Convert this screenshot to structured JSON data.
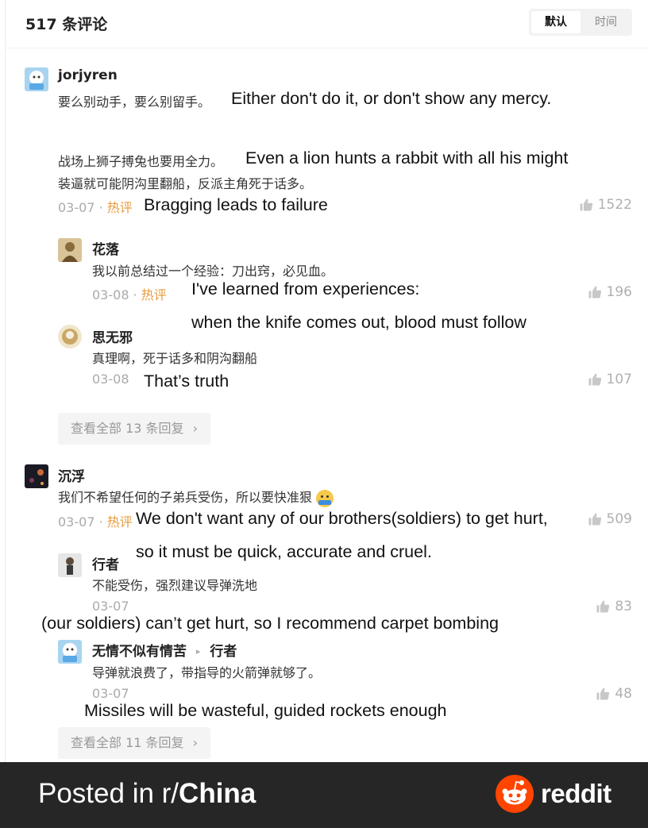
{
  "header": {
    "title": "517 条评论",
    "sort_default": "默认",
    "sort_time": "时间"
  },
  "comments": [
    {
      "user": "jorjyren",
      "line1": "要么别动手，要么别留手。",
      "line1_en": "Either don't do it, or don't show any mercy.",
      "line2": "战场上狮子搏兔也要用全力。",
      "line2_en": "Even a lion hunts a rabbit with all his might",
      "line3": "装逼就可能阴沟里翻船，反派主角死于话多。",
      "date": "03-07 · ",
      "hot": "热评",
      "meta_en": "Bragging leads to failure",
      "likes": "1522",
      "replies": [
        {
          "user": "花落",
          "text": "我以前总结过一个经验：刀出窍，必见血。",
          "date": "03-08 · ",
          "hot": "热评",
          "en1": "I've learned from experiences:",
          "en2": "when the knife comes out, blood must follow",
          "likes": "196"
        },
        {
          "user": "思无邪",
          "text": "真理啊，死于话多和阴沟翻船",
          "date": "03-08",
          "en1": "That’s truth",
          "likes": "107"
        }
      ],
      "more": "查看全部 13 条回复"
    },
    {
      "user": "沉浮",
      "line1": "我们不希望任何的子弟兵受伤，所以要快准狠",
      "date": "03-07 · ",
      "hot": "热评",
      "meta_en": "We don't want any of our brothers(soldiers) to get hurt,",
      "meta_en2": "so it must be quick, accurate and cruel.",
      "likes": "509",
      "replies": [
        {
          "user": "行者",
          "text": "不能受伤，强烈建议导弹洗地",
          "date": "03-07",
          "en1": "(our soldiers) can’t get hurt, so I recommend carpet bombing",
          "likes": "83"
        },
        {
          "user": "无情不似有情苦",
          "reply_to": "行者",
          "text": "导弹就浪费了，带指导的火箭弹就够了。",
          "date": "03-07",
          "en1": "Missiles will be wasteful, guided rockets enough",
          "likes": "48"
        }
      ],
      "more": "查看全部 11 条回复"
    }
  ],
  "footer": {
    "posted_prefix": "Posted in r/",
    "subreddit": "China",
    "brand": "reddit"
  },
  "colors": {
    "hot": "#e89a3c",
    "footer_bg": "#262626",
    "reddit_orange": "#ff4500"
  }
}
